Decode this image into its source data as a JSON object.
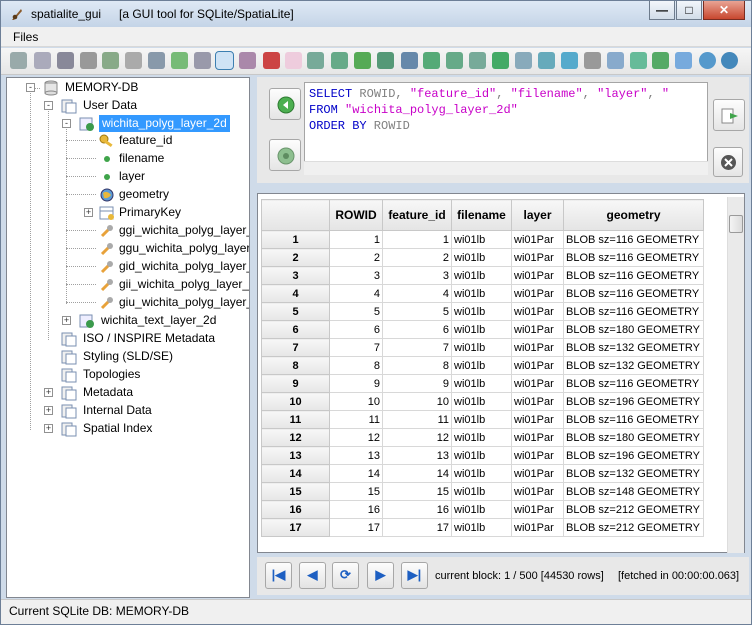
{
  "window": {
    "app_name": "spatialite_gui",
    "subtitle": "[a GUI tool for SQLite/SpatiaLite]",
    "min": "—",
    "max": "□",
    "close": "✕"
  },
  "menu": {
    "files": "Files"
  },
  "tree": {
    "root": "MEMORY-DB",
    "user_data": "User Data",
    "table": "wichita_polyg_layer_2d",
    "cols": [
      "feature_id",
      "filename",
      "layer",
      "geometry"
    ],
    "pk": "PrimaryKey",
    "triggers": [
      "ggi_wichita_polyg_layer_",
      "ggu_wichita_polyg_layer",
      "gid_wichita_polyg_layer_",
      "gii_wichita_polyg_layer_",
      "giu_wichita_polyg_layer_"
    ],
    "table2": "wichita_text_layer_2d",
    "folders": [
      "ISO / INSPIRE Metadata",
      "Styling (SLD/SE)",
      "Topologies",
      "Metadata",
      "Internal Data",
      "Spatial Index"
    ]
  },
  "sql": {
    "l1_kw": "SELECT",
    "l1_rest": " ROWID, ",
    "l1_s1": "\"feature_id\"",
    "l1_c": ", ",
    "l1_s2": "\"filename\"",
    "l1_c2": ", ",
    "l1_s3": "\"layer\"",
    "l1_c3": ", ",
    "l1_s4": "\"",
    "l2_kw": "FROM",
    "l2_s": " \"wichita_polyg_layer_2d\"",
    "l3_kw": "ORDER BY",
    "l3_id": " ROWID"
  },
  "grid": {
    "headers": [
      "ROWID",
      "feature_id",
      "filename",
      "layer",
      "geometry"
    ],
    "rows": [
      [
        "1",
        "1",
        "1",
        "wi01lb",
        "wi01Par",
        "BLOB sz=116 GEOMETRY"
      ],
      [
        "2",
        "2",
        "2",
        "wi01lb",
        "wi01Par",
        "BLOB sz=116 GEOMETRY"
      ],
      [
        "3",
        "3",
        "3",
        "wi01lb",
        "wi01Par",
        "BLOB sz=116 GEOMETRY"
      ],
      [
        "4",
        "4",
        "4",
        "wi01lb",
        "wi01Par",
        "BLOB sz=116 GEOMETRY"
      ],
      [
        "5",
        "5",
        "5",
        "wi01lb",
        "wi01Par",
        "BLOB sz=116 GEOMETRY"
      ],
      [
        "6",
        "6",
        "6",
        "wi01lb",
        "wi01Par",
        "BLOB sz=180 GEOMETRY"
      ],
      [
        "7",
        "7",
        "7",
        "wi01lb",
        "wi01Par",
        "BLOB sz=132 GEOMETRY"
      ],
      [
        "8",
        "8",
        "8",
        "wi01lb",
        "wi01Par",
        "BLOB sz=132 GEOMETRY"
      ],
      [
        "9",
        "9",
        "9",
        "wi01lb",
        "wi01Par",
        "BLOB sz=116 GEOMETRY"
      ],
      [
        "10",
        "10",
        "10",
        "wi01lb",
        "wi01Par",
        "BLOB sz=196 GEOMETRY"
      ],
      [
        "11",
        "11",
        "11",
        "wi01lb",
        "wi01Par",
        "BLOB sz=116 GEOMETRY"
      ],
      [
        "12",
        "12",
        "12",
        "wi01lb",
        "wi01Par",
        "BLOB sz=180 GEOMETRY"
      ],
      [
        "13",
        "13",
        "13",
        "wi01lb",
        "wi01Par",
        "BLOB sz=196 GEOMETRY"
      ],
      [
        "14",
        "14",
        "14",
        "wi01lb",
        "wi01Par",
        "BLOB sz=132 GEOMETRY"
      ],
      [
        "15",
        "15",
        "15",
        "wi01lb",
        "wi01Par",
        "BLOB sz=148 GEOMETRY"
      ],
      [
        "16",
        "16",
        "16",
        "wi01lb",
        "wi01Par",
        "BLOB sz=212 GEOMETRY"
      ],
      [
        "17",
        "17",
        "17",
        "wi01lb",
        "wi01Par",
        "BLOB sz=212 GEOMETRY"
      ]
    ]
  },
  "nav": {
    "block": "current block: 1 / 500 [44530 rows]",
    "fetched": "[fetched in 00:00:00.063]"
  },
  "status": "Current SQLite DB: MEMORY-DB"
}
